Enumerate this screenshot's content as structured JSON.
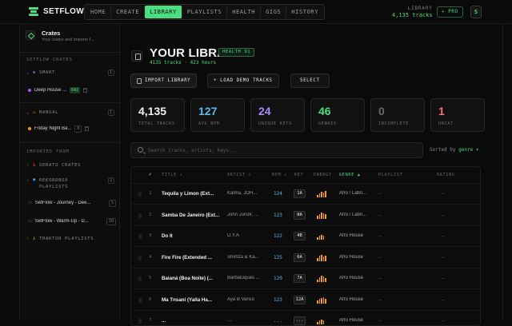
{
  "app": {
    "name": "SETFLOW"
  },
  "nav": {
    "tabs": [
      {
        "label": "HOME",
        "active": false
      },
      {
        "label": "CREATE",
        "active": false
      },
      {
        "label": "LIBRARY",
        "active": true
      },
      {
        "label": "PLAYLISTS",
        "active": false
      },
      {
        "label": "HEALTH",
        "active": false
      },
      {
        "label": "GIGS",
        "active": false
      },
      {
        "label": "HISTORY",
        "active": false
      }
    ]
  },
  "header_right": {
    "library_label": "LIBRARY",
    "library_count": "4,135 tracks",
    "pro_label": "✦ PRO",
    "avatar_letter": "S"
  },
  "sidebar": {
    "title": "Crates",
    "subtitle": "Your crates and imports f...",
    "setflow_crates_label": "SETFLOW CRATES",
    "smart": {
      "label": "SMART",
      "count": "1",
      "item": {
        "label": "Deep House ...",
        "badge": "642",
        "color": "#a855f7"
      }
    },
    "manual": {
      "label": "MANUAL",
      "count": "1",
      "item": {
        "label": "Friday Night Ba...",
        "badge": "0",
        "color": "#f59e0b"
      }
    },
    "imported_label": "IMPORTED FROM",
    "serato": {
      "label": "SERATO CRATES"
    },
    "rekordbox": {
      "label": "REKORDBOX PLAYLISTS",
      "count": "2"
    },
    "rb_items": [
      {
        "label": "SetFlow - Journey - Dee...",
        "badge": "5"
      },
      {
        "label": "SetFlow - Warm-Up - D...",
        "badge": "10"
      }
    ],
    "traktor": {
      "label": "TRAKTOR PLAYLISTS"
    }
  },
  "main": {
    "title": "YOUR LIBRARY",
    "health_badge": "HEALTH 91",
    "tracks_text": "4135 tracks",
    "sep": "·",
    "hours_text": "423 hours",
    "import_label": "IMPORT LIBRARY",
    "demo_label": "+ LOAD DEMO TRACKS",
    "select_label": "SELECT",
    "stats": [
      {
        "value": "4,135",
        "label": "TOTAL TRACKS",
        "color": "#f2f2f2"
      },
      {
        "value": "127",
        "label": "AVG BPM",
        "color": "#5eb8f0"
      },
      {
        "value": "24",
        "label": "UNIQUE KEYS",
        "color": "#a78bfa"
      },
      {
        "value": "46",
        "label": "GENRES",
        "color": "#4ade80"
      },
      {
        "value": "0",
        "label": "INCOMPLETE",
        "color": "#6a6a6a"
      },
      {
        "value": "1",
        "label": "UNCAT",
        "color": "#f87171"
      }
    ],
    "search_placeholder": "Search tracks, artists, keys...",
    "sorted_by_label": "Sorted by",
    "sorted_by_value": "genre ▾",
    "columns": [
      "#",
      "TITLE ⇕",
      "ARTIST ⇕",
      "BPM ⇕",
      "KEY",
      "ENERGY",
      "GENRE ▲",
      "PLAYLIST",
      "RATING"
    ],
    "rows": [
      {
        "n": "1",
        "title": "Tequila y Limon (Ext...",
        "artist": "Kalma, JOH...",
        "bpm": "124",
        "key": "1A",
        "energy": 5,
        "genre": "Afro / Latin...",
        "playlist": "—",
        "rating": "—"
      },
      {
        "n": "2",
        "title": "Samba De Janeiro (Ext...",
        "artist": "John Junior, ...",
        "bpm": "123",
        "key": "8A",
        "energy": 5,
        "genre": "Afro / Latin...",
        "playlist": "—",
        "rating": "—"
      },
      {
        "n": "3",
        "title": "Do It",
        "artist": "D.Y.A",
        "bpm": "122",
        "key": "4B",
        "energy": 4,
        "genre": "Afro House",
        "playlist": "—",
        "rating": "—"
      },
      {
        "n": "4",
        "title": "Fire Fire (Extended ...",
        "artist": "Shimza & Ka...",
        "bpm": "125",
        "key": "6A",
        "energy": 5,
        "genre": "Afro House",
        "playlist": "—",
        "rating": "—"
      },
      {
        "n": "5",
        "title": "Baianá (Boa Noite) (...",
        "artist": "Barbatuques ...",
        "bpm": "120",
        "key": "7A",
        "energy": 5,
        "genre": "Afro House",
        "playlist": "—",
        "rating": "—"
      },
      {
        "n": "6",
        "title": "Ma Tnsani (Yalla Ha...",
        "artist": "Aya B Vanco",
        "bpm": "123",
        "key": "12A",
        "energy": 5,
        "genre": "Afro House",
        "playlist": "—",
        "rating": "—"
      },
      {
        "n": "7",
        "title": "...",
        "artist": "...",
        "bpm": "...",
        "key": "...",
        "energy": 4,
        "genre": "Afro House",
        "playlist": "—",
        "rating": "—"
      }
    ]
  }
}
